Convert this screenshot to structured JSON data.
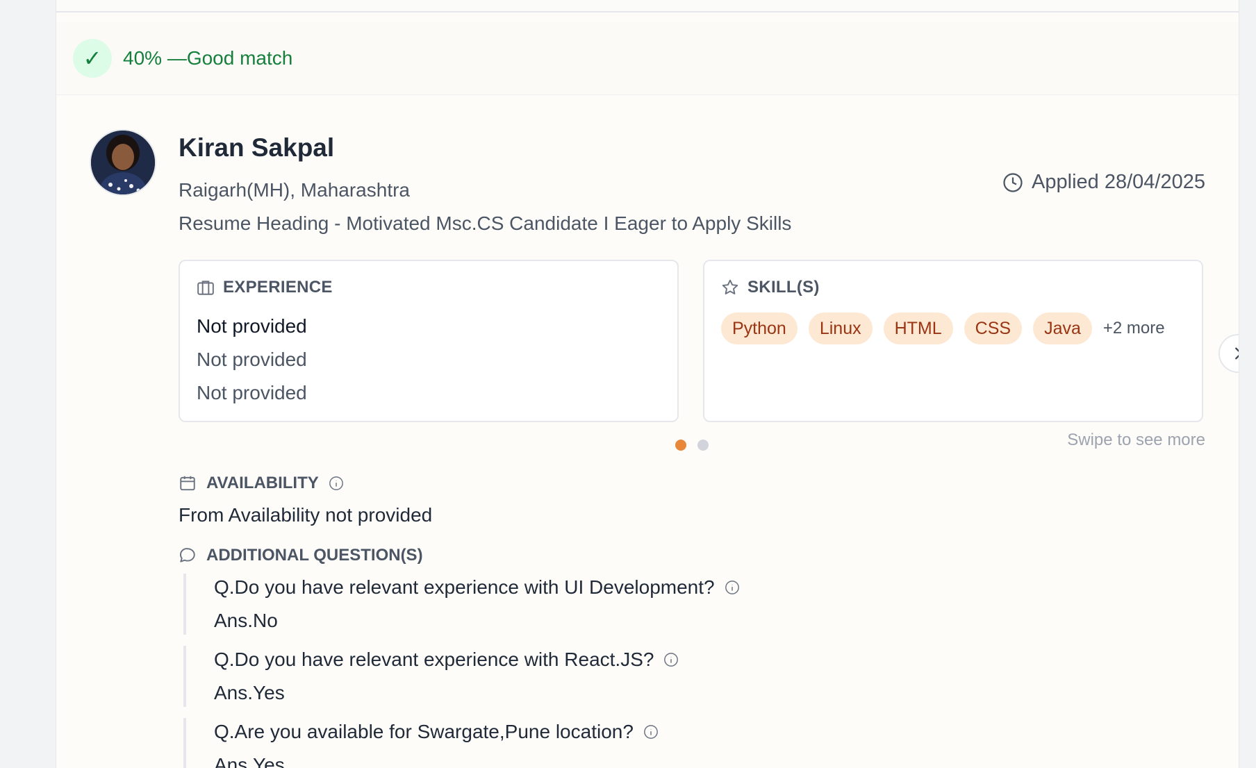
{
  "match": {
    "text": "40% —Good match",
    "check": "✓"
  },
  "candidate": {
    "name": "Kiran Sakpal",
    "location": "Raigarh(MH), Maharashtra",
    "resume_heading": "Resume Heading - Motivated Msc.CS Candidate I Eager to Apply Skills",
    "applied": "Applied 28/04/2025"
  },
  "experience": {
    "title": "EXPERIENCE",
    "lines": [
      "Not provided",
      "Not provided",
      "Not provided"
    ]
  },
  "skills": {
    "title": "SKILL(S)",
    "items": [
      "Python",
      "Linux",
      "HTML",
      "CSS",
      "Java"
    ],
    "more": "+2 more"
  },
  "carousel": {
    "swipe_hint": "Swipe to see more",
    "active_index": 0,
    "count": 2
  },
  "availability": {
    "title": "AVAILABILITY",
    "text": "From Availability not provided"
  },
  "additional_questions": {
    "title": "ADDITIONAL QUESTION(S)",
    "items": [
      {
        "q": "Q.Do you have relevant experience with UI Development?",
        "a": "Ans.No"
      },
      {
        "q": "Q.Do you have relevant experience with React.JS?",
        "a": "Ans.Yes"
      },
      {
        "q": "Q.Are you available for Swargate,Pune location?",
        "a": "Ans.Yes"
      }
    ]
  },
  "colors": {
    "accent": "#e8873a",
    "match_green": "#15803d",
    "chip_bg": "#fde9d3",
    "chip_text": "#9a3412"
  },
  "icons": [
    "check-icon",
    "clock-icon",
    "briefcase-icon",
    "star-icon",
    "chevron-right-icon",
    "calendar-icon",
    "info-icon",
    "chat-icon"
  ]
}
